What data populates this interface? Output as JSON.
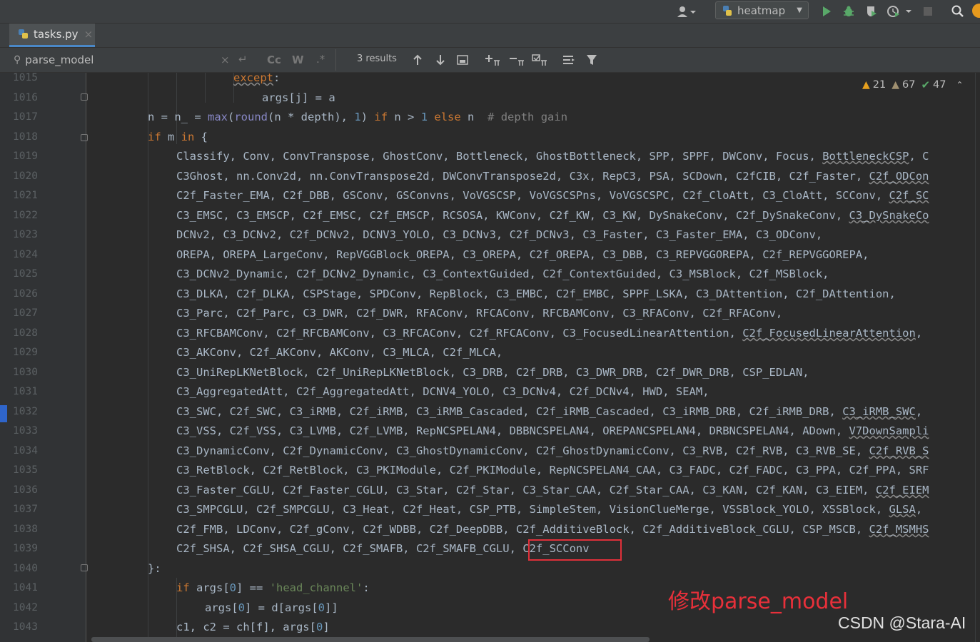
{
  "toolbar": {
    "user_icon": "user-dropdown-icon",
    "run_config_label": "heatmap",
    "run_icon": "play-icon",
    "debug_icon": "bug-icon",
    "coverage_icon": "coverage-icon",
    "profile_icon": "profile-icon",
    "stop_icon": "stop-icon",
    "search_icon": "search-icon",
    "colors": {
      "run": "#59a869",
      "debug": "#59a869",
      "stop": "#5c5c5c"
    }
  },
  "tab": {
    "label": "tasks.py",
    "close": "×"
  },
  "search": {
    "value": "parse_model",
    "results": "3 results",
    "match_case": "Cc",
    "words": "W",
    "regex": ".*"
  },
  "inspections": {
    "warnings": "21",
    "weak_warnings": "67",
    "typos": "47"
  },
  "lines": [
    {
      "n": "1015"
    },
    {
      "n": "1016"
    },
    {
      "n": "1017"
    },
    {
      "n": "1018"
    },
    {
      "n": "1019"
    },
    {
      "n": "1020"
    },
    {
      "n": "1021"
    },
    {
      "n": "1022"
    },
    {
      "n": "1023"
    },
    {
      "n": "1024"
    },
    {
      "n": "1025"
    },
    {
      "n": "1026"
    },
    {
      "n": "1027"
    },
    {
      "n": "1028"
    },
    {
      "n": "1029"
    },
    {
      "n": "1030"
    },
    {
      "n": "1031"
    },
    {
      "n": "1032"
    },
    {
      "n": "1033"
    },
    {
      "n": "1034"
    },
    {
      "n": "1035"
    },
    {
      "n": "1036"
    },
    {
      "n": "1037"
    },
    {
      "n": "1038"
    },
    {
      "n": "1039"
    },
    {
      "n": "1040"
    },
    {
      "n": "1041"
    },
    {
      "n": "1042"
    },
    {
      "n": "1043"
    }
  ],
  "code": {
    "l1015": {
      "kw": "except",
      "rest": ":"
    },
    "l1016": {
      "text": "args[j] = a"
    },
    "l1017": {
      "a": "n = n_ = ",
      "max": "max",
      "b": "(",
      "round": "round",
      "c": "(n * depth), ",
      "one": "1",
      "d": ") ",
      "if": "if",
      "e": " n > ",
      "one2": "1",
      "f": " ",
      "else": "else",
      "g": " n  ",
      "cmt": "# depth gain"
    },
    "l1018": {
      "if": "if",
      "a": " m ",
      "in": "in",
      "b": " {"
    },
    "l1019": {
      "text": "Classify, Conv, ConvTranspose, GhostConv, Bottleneck, GhostBottleneck, SPP, SPPF, DWConv, Focus, ",
      "u": "BottleneckCSP",
      "end": ", C"
    },
    "l1020": {
      "text": "C3Ghost, nn.Conv2d, nn.ConvTranspose2d, DWConvTranspose2d, C3x, RepC3, PSA, SCDown, C2fCIB, C2f_Faster, ",
      "u": "C2f_ODCon"
    },
    "l1021": {
      "text": "C2f_Faster_EMA, C2f_DBB, GSConv, GSConvns, VoVGSCSP, VoVGSCSPns, VoVGSCSPC, C2f_CloAtt, C3_CloAtt, SCConv, ",
      "u": "C2f_SC"
    },
    "l1022": {
      "text": "C3_EMSC, C3_EMSCP, C2f_EMSC, C2f_EMSCP, RCSOSA, KWConv, C2f_KW, C3_KW, DySnakeConv, C2f_DySnakeConv, ",
      "u": "C3_DySnakeCo"
    },
    "l1023": {
      "text": "DCNv2, C3_DCNv2, C2f_DCNv2, DCNV3_YOLO, C3_DCNv3, C2f_DCNv3, C3_Faster, C3_Faster_EMA, C3_ODConv,"
    },
    "l1024": {
      "text": "OREPA, OREPA_LargeConv, RepVGGBlock_OREPA, C3_OREPA, C2f_OREPA, C3_DBB, C3_REPVGGOREPA, C2f_REPVGGOREPA,"
    },
    "l1025": {
      "text": "C3_DCNv2_Dynamic, C2f_DCNv2_Dynamic, C3_ContextGuided, C2f_ContextGuided, C3_MSBlock, C2f_MSBlock,"
    },
    "l1026": {
      "text": "C3_DLKA, C2f_DLKA, CSPStage, SPDConv, RepBlock, C3_EMBC, C2f_EMBC, SPPF_LSKA, C3_DAttention, C2f_DAttention,"
    },
    "l1027": {
      "text": "C3_Parc, C2f_Parc, C3_DWR, C2f_DWR, RFAConv, RFCAConv, RFCBAMConv, C3_RFAConv, C2f_RFAConv,"
    },
    "l1028": {
      "text": "C3_RFCBAMConv, C2f_RFCBAMConv, C3_RFCAConv, C2f_RFCAConv, C3_FocusedLinearAttention, ",
      "u": "C2f_FocusedLinearAttention",
      "end": ","
    },
    "l1029": {
      "text": "C3_AKConv, C2f_AKConv, AKConv, C3_MLCA, C2f_MLCA,"
    },
    "l1030": {
      "text": "C3_UniRepLKNetBlock, C2f_UniRepLKNetBlock, C3_DRB, C2f_DRB, C3_DWR_DRB, C2f_DWR_DRB, CSP_EDLAN,"
    },
    "l1031": {
      "text": "C3_AggregatedAtt, C2f_AggregatedAtt, DCNV4_YOLO, C3_DCNv4, C2f_DCNv4, HWD, SEAM,"
    },
    "l1032": {
      "text": "C3_SWC, C2f_SWC, C3_iRMB, C2f_iRMB, C3_iRMB_Cascaded, C2f_iRMB_Cascaded, C3_iRMB_DRB, C2f_iRMB_DRB, ",
      "u": "C3_iRMB_SWC",
      "end": ","
    },
    "l1033": {
      "text": "C3_VSS, C2f_VSS, C3_LVMB, C2f_LVMB, RepNCSPELAN4, DBBNCSPELAN4, OREPANCSPELAN4, DRBNCSPELAN4, ADown, ",
      "u": "V7DownSampli"
    },
    "l1034": {
      "text": "C3_DynamicConv, C2f_DynamicConv, C3_GhostDynamicConv, C2f_GhostDynamicConv, C3_RVB, C2f_RVB, C3_RVB_SE, ",
      "u": "C2f_RVB_S"
    },
    "l1035": {
      "text": "C3_RetBlock, C2f_RetBlock, C3_PKIModule, C2f_PKIModule, RepNCSPELAN4_CAA, C3_FADC, C2f_FADC, C3_PPA, C2f_PPA, SRF"
    },
    "l1036": {
      "text": "C3_Faster_CGLU, C2f_Faster_CGLU, C3_Star, C2f_Star, C3_Star_CAA, C2f_Star_CAA, C3_KAN, C2f_KAN, C3_EIEM, ",
      "u": "C2f_EIEM"
    },
    "l1037": {
      "text": "C3_SMPCGLU, C2f_SMPCGLU, C3_Heat, C2f_Heat, CSP_PTB, SimpleStem, VisionClueMerge, VSSBlock_YOLO, XSSBlock, ",
      "u": "GLSA",
      "end": ","
    },
    "l1038": {
      "text": "C2f_FMB, LDConv, C2f_gConv, C2f_WDBB, C2f_DeepDBB, C2f_AdditiveBlock, C2f_AdditiveBlock_CGLU, CSP_MSCB, ",
      "u": "C2f_MSMHS"
    },
    "l1039": {
      "text": "C2f_SHSA, C2f_SHSA_CGLU, C2f_SMAFB, C2f_SMAFB_CGLU, C2f_SCConv"
    },
    "l1040": {
      "text": "}:"
    },
    "l1041": {
      "if": "if",
      "a": " args[",
      "zero": "0",
      "b": "] == ",
      "str": "'head_channel'",
      "c": ":"
    },
    "l1042": {
      "a": "args[",
      "zero": "0",
      "b": "] = d[args[",
      "zero2": "0",
      "c": "]]"
    },
    "l1043": {
      "a": "c1, c2 = ch[f], args[",
      "zero": "0",
      "b": "]"
    }
  },
  "annotation": "修改parse_model",
  "watermark": "CSDN @Stara-AI"
}
